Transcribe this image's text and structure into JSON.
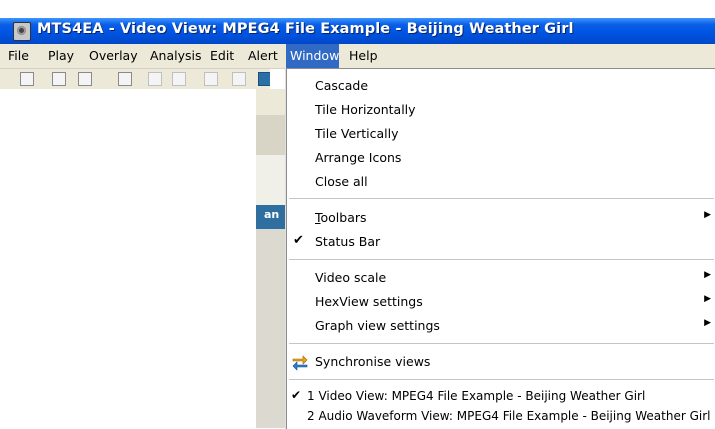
{
  "window": {
    "title": "MTS4EA - Video View: MPEG4 File Example - Beijing Weather Girl"
  },
  "menubar": {
    "items": [
      "File",
      "Play",
      "Overlay",
      "Analysis",
      "Edit",
      "Alert",
      "Window",
      "Help"
    ],
    "active": "Window"
  },
  "background_fragment": {
    "text": "an"
  },
  "window_menu": {
    "cascade": "Cascade",
    "tile_h": "Tile Horizontally",
    "tile_v": "Tile Vertically",
    "arrange": "Arrange Icons",
    "close_all": "Close all",
    "toolbars_pre": "",
    "toolbars_u": "T",
    "toolbars_post": "oolbars",
    "status_bar": "Status Bar",
    "status_bar_checked": true,
    "video_scale": "Video scale",
    "hexview": "HexView settings",
    "graph": "Graph view settings",
    "sync": "Synchronise views",
    "open_windows": [
      {
        "label": "1 Video View: MPEG4 File Example - Beijing Weather Girl",
        "checked": true
      },
      {
        "label": "2 Audio Waveform View: MPEG4 File Example - Beijing Weather Girl",
        "checked": false
      }
    ]
  },
  "icons": {
    "check": "checkmark-icon",
    "submenu": "submenu-arrow-icon",
    "sync": "sync-views-icon",
    "app": "app-icon"
  }
}
